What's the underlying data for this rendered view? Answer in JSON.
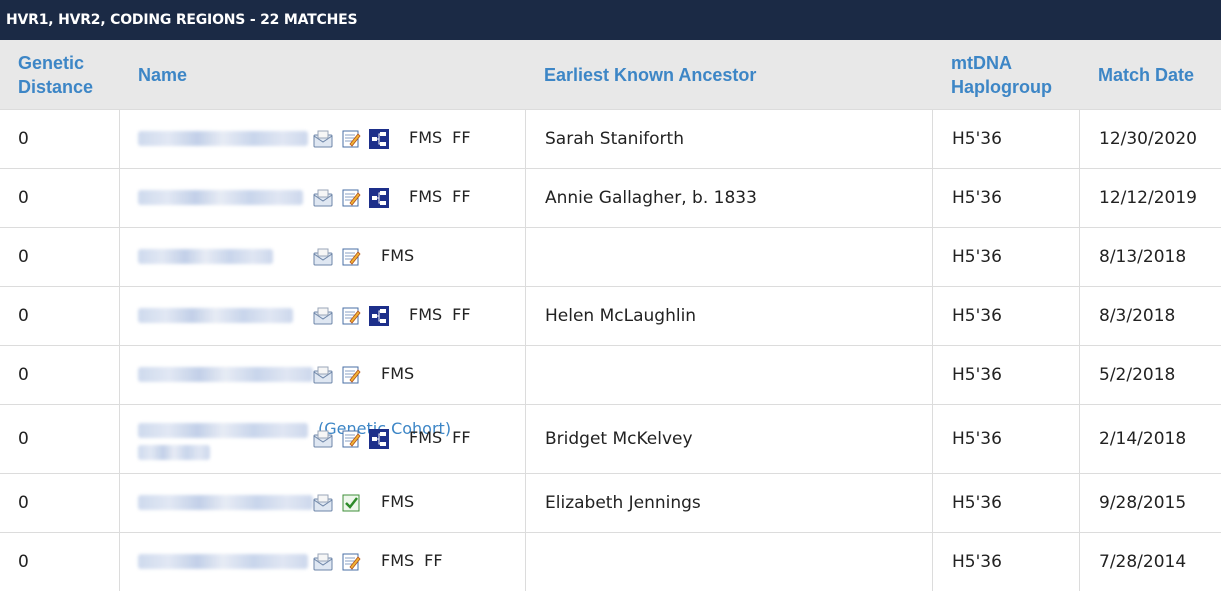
{
  "title": "HVR1, HVR2, CODING REGIONS - 22 MATCHES",
  "headers": {
    "distance": "Genetic Distance",
    "name": "Name",
    "ancestor": "Earliest Known Ancestor",
    "haplogroup": "mtDNA Haplogroup",
    "date": "Match Date"
  },
  "colors": {
    "titlebar": "#1b2a45",
    "header_bg": "#e8e8e8",
    "header_text": "#3d86c6",
    "blur_name": "#c9d6ec"
  },
  "rows": [
    {
      "distance": "0",
      "icons": [
        "email-icon",
        "notes-icon",
        "tree-icon"
      ],
      "tags": [
        "FMS",
        "FF"
      ],
      "ancestor": "Sarah Staniforth",
      "haplogroup": "H5'36",
      "date": "12/30/2020"
    },
    {
      "distance": "0",
      "icons": [
        "email-icon",
        "notes-icon",
        "tree-icon"
      ],
      "tags": [
        "FMS",
        "FF"
      ],
      "ancestor": "Annie Gallagher, b. 1833",
      "haplogroup": "H5'36",
      "date": "12/12/2019"
    },
    {
      "distance": "0",
      "icons": [
        "email-icon",
        "notes-icon"
      ],
      "tags": [
        "FMS"
      ],
      "ancestor": "",
      "haplogroup": "H5'36",
      "date": "8/13/2018"
    },
    {
      "distance": "0",
      "icons": [
        "email-icon",
        "notes-icon",
        "tree-icon"
      ],
      "tags": [
        "FMS",
        "FF"
      ],
      "ancestor": "Helen McLaughlin",
      "haplogroup": "H5'36",
      "date": "8/3/2018"
    },
    {
      "distance": "0",
      "icons": [
        "email-icon",
        "notes-icon"
      ],
      "tags": [
        "FMS"
      ],
      "ancestor": "",
      "haplogroup": "H5'36",
      "date": "5/2/2018"
    },
    {
      "distance": "0",
      "icons": [
        "email-icon",
        "notes-icon",
        "tree-icon"
      ],
      "tags": [
        "FMS",
        "FF"
      ],
      "ancestor": "Bridget McKelvey",
      "haplogroup": "H5'36",
      "date": "2/14/2018",
      "ghost": "(Genetic Cohort)"
    },
    {
      "distance": "0",
      "icons": [
        "email-icon",
        "notes-checked-icon"
      ],
      "tags": [
        "FMS"
      ],
      "ancestor": "Elizabeth Jennings",
      "haplogroup": "H5'36",
      "date": "9/28/2015"
    },
    {
      "distance": "0",
      "icons": [
        "email-icon",
        "notes-icon"
      ],
      "tags": [
        "FMS",
        "FF"
      ],
      "ancestor": "",
      "haplogroup": "H5'36",
      "date": "7/28/2014"
    }
  ]
}
